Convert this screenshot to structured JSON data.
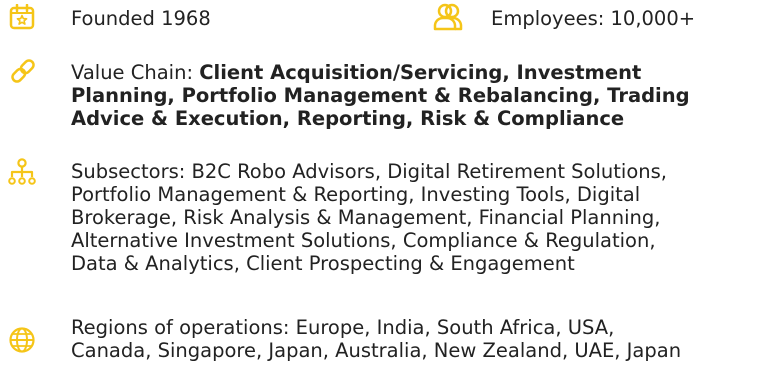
{
  "founded": {
    "label": "Founded 1968",
    "icon": "calendar-star-icon"
  },
  "employees": {
    "label": "Employees: 10,000+",
    "icon": "people-icon"
  },
  "value_chain": {
    "label": "Value Chain: ",
    "lines": [
      "Client Acquisition/Servicing, Investment",
      "Planning, Portfolio Management & Rebalancing, Trading",
      "Advice & Execution, Reporting, Risk & Compliance"
    ],
    "icon": "link-icon"
  },
  "subsectors": {
    "lines": [
      "Subsectors: B2C Robo Advisors, Digital Retirement Solutions,",
      "Portfolio Management & Reporting, Investing Tools, Digital",
      "Brokerage, Risk Analysis & Management, Financial Planning,",
      "Alternative Investment Solutions, Compliance & Regulation,",
      "Data & Analytics, Client Prospecting & Engagement"
    ],
    "icon": "org-chart-icon"
  },
  "regions": {
    "lines": [
      "Regions of operations: Europe, India, South Africa, USA,",
      "Canada, Singapore, Japan, Australia, New Zealand, UAE, Japan"
    ],
    "icon": "globe-icon"
  },
  "accent_color": "#F5C518"
}
